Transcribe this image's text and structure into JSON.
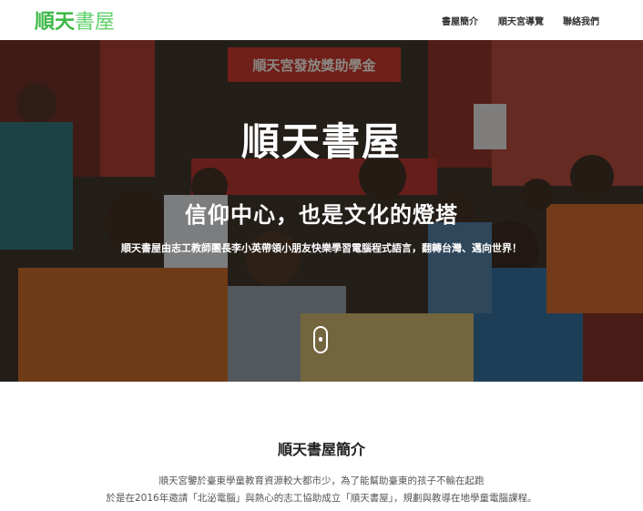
{
  "nav": {
    "logo_strong": "順天",
    "logo_light": "書屋",
    "links": [
      "書屋簡介",
      "順天宮導覽",
      "聯絡我們"
    ]
  },
  "hero": {
    "banner_text": "順天宮發放獎助學金",
    "title": "順天書屋",
    "subtitle": "信仰中心，也是文化的燈塔",
    "description": "順天書屋由志工教師團長李小英帶領小朋友快樂學習電腦程式語言，翻轉台灣、邁向世界！"
  },
  "intro": {
    "title": "順天書屋簡介",
    "lines": [
      "順天宮鑒於臺東學童教育資源較大都市少，為了能幫助臺東的孩子不輸在起跑",
      "於是在2016年邀請「北泌電腦」與熱心的志工協助成立「順天書屋」，規劃與教導在地學童電腦課程。"
    ]
  },
  "colors": {
    "brand": "#3cb846",
    "text": "#222222",
    "muted": "#555555"
  }
}
